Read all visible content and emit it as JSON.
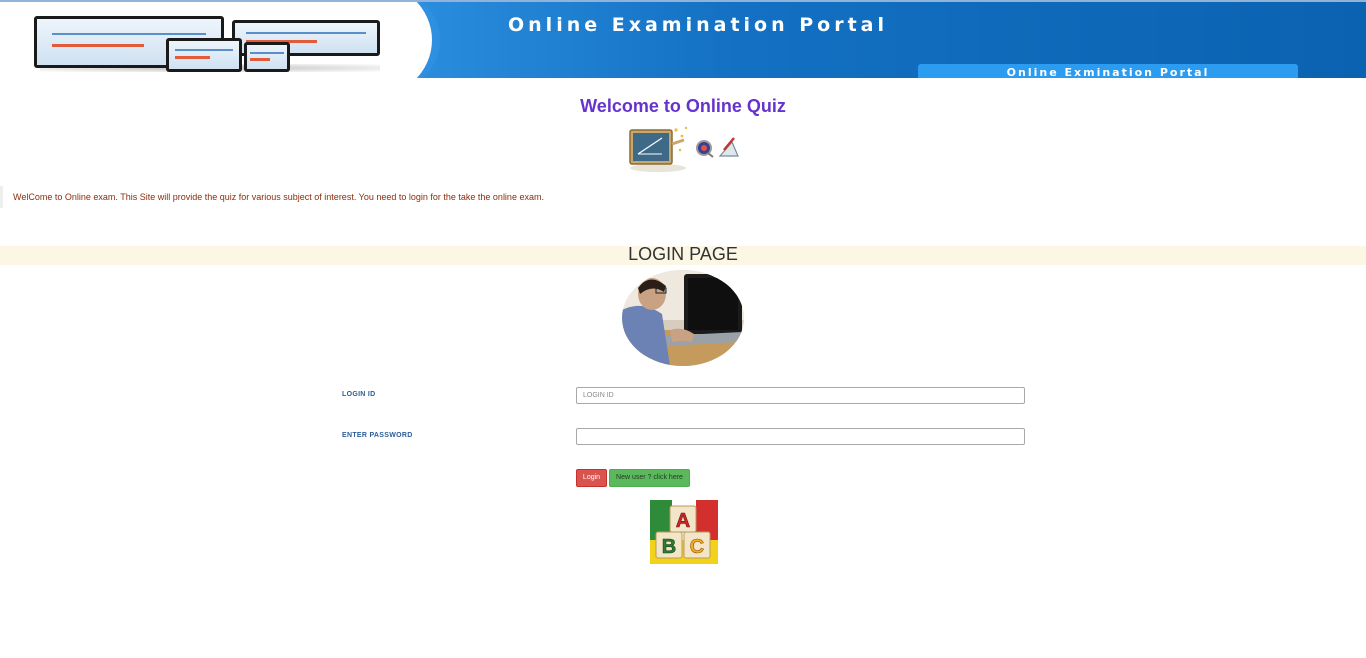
{
  "banner": {
    "title": "Online  Examination  Portal",
    "subtitle": "Online Exmination Portal"
  },
  "welcome": {
    "heading": "Welcome to Online Quiz",
    "intro": "WelCome to Online exam. This Site will provide the quiz for various subject of interest. You need to login for the take the online exam."
  },
  "login": {
    "title": "LOGIN PAGE",
    "login_id_label": "LOGIN ID",
    "login_id_placeholder": "LOGIN ID",
    "password_label": "ENTER PASSWORD",
    "password_value": "",
    "login_button": "Login",
    "new_user_button": "New user ? click here"
  },
  "images": {
    "abc_letters": [
      "A",
      "B",
      "C"
    ]
  },
  "colors": {
    "banner_blue": "#0b62b1",
    "welcome_purple": "#6633cc",
    "intro_text": "#8b2d0a",
    "label_blue": "#2b5d9a",
    "login_red": "#d9534f",
    "new_user_green": "#5cb85c",
    "band_cream": "#fcf6e4"
  }
}
